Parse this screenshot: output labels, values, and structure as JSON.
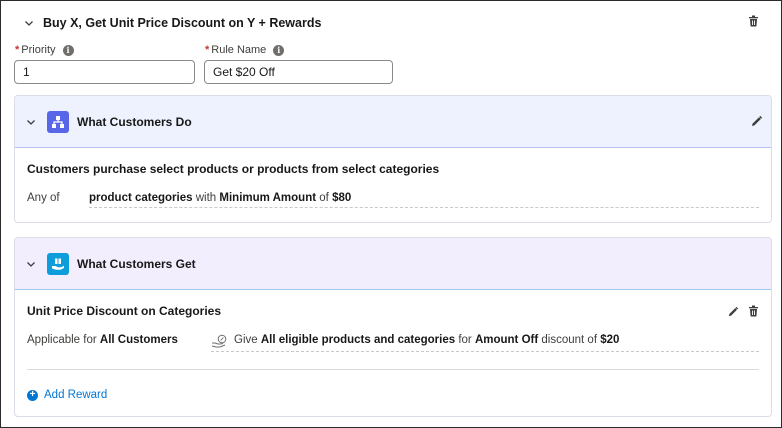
{
  "rule": {
    "title": "Buy X, Get Unit Price Discount on Y + Rewards",
    "priority_label": "Priority",
    "priority_value": "1",
    "rule_name_label": "Rule Name",
    "rule_name_value": "Get $20 Off"
  },
  "customers_do": {
    "title": "What Customers Do",
    "header_color": "#eef1fe",
    "header_border": "#b7c2f5",
    "icon_color": "#5867e8",
    "section_title": "Customers purchase select products or products from select categories",
    "prefix": "Any of",
    "condition": {
      "items": "product categories",
      "with": "with",
      "metric": "Minimum Amount",
      "of": "of",
      "value": "$80"
    }
  },
  "customers_get": {
    "title": "What Customers Get",
    "header_color": "#f3eefd",
    "header_border": "#9ec6ef",
    "icon_color": "#0d9dda",
    "section_title": "Unit Price Discount on Categories",
    "applicable_prefix": "Applicable for",
    "applicable_value": "All Customers",
    "give": "Give",
    "targets": "All eligible products and categories",
    "for": "for",
    "discount_type": "Amount Off",
    "discount_of": "discount of",
    "discount_value": "$20",
    "add_reward": "Add Reward"
  },
  "icons": {
    "chevron": "chevron-down-icon",
    "trash": "trash-icon",
    "edit": "pencil-icon",
    "info": "info-icon",
    "hierarchy": "hierarchy-icon",
    "reward": "gift-hand-icon",
    "discount": "discount-hand-icon",
    "add": "add-icon"
  }
}
